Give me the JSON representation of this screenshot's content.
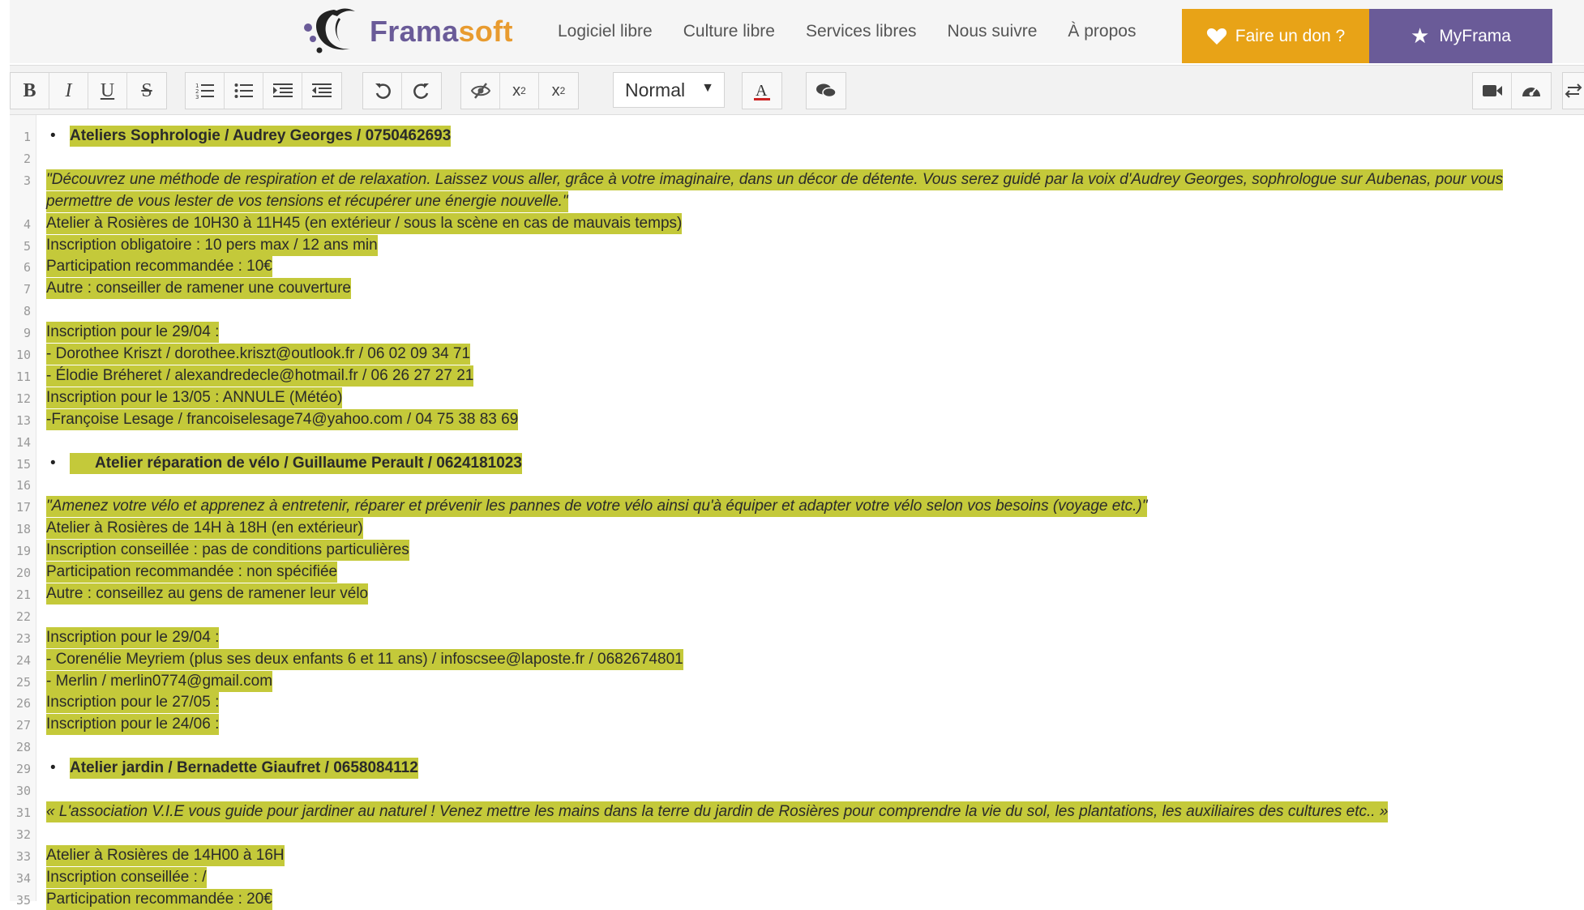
{
  "nav": {
    "brand_part1": "Frama",
    "brand_part2": "soft",
    "links": [
      "Logiciel libre",
      "Culture libre",
      "Services libres",
      "Nous suivre",
      "À propos"
    ],
    "donate_label": "Faire un don ?",
    "myframa_label": "MyFrama"
  },
  "toolbar": {
    "format_value": "Normal",
    "format_caret": "▼"
  },
  "lines": [
    {
      "n": "1",
      "bullet": true,
      "text": "Ateliers Sophrologie / Audrey Georges / 0750462693",
      "style": "b"
    },
    {
      "n": "2",
      "text": ""
    },
    {
      "n": "3",
      "text": "\"Découvrez une méthode de respiration et de relaxation. Laissez vous aller, grâce à votre imaginaire, dans un décor de détente. Vous serez guidé par la voix d'Audrey Georges, sophrologue sur Aubenas, pour vous",
      "style": "i"
    },
    {
      "n": "",
      "text": "permettre de vous lester de vos tensions et récupérer une énergie nouvelle.\"",
      "style": "i"
    },
    {
      "n": "4",
      "text": "Atelier à Rosières de 10H30 à 11H45 (en extérieur / sous la scène en cas de mauvais temps)"
    },
    {
      "n": "5",
      "text": "Inscription obligatoire : 10 pers max / 12 ans min"
    },
    {
      "n": "6",
      "text": "Participation recommandée : 10€"
    },
    {
      "n": "7",
      "text": "Autre : conseiller de ramener une couverture"
    },
    {
      "n": "8",
      "text": ""
    },
    {
      "n": "9",
      "text": "Inscription pour le 29/04 :"
    },
    {
      "n": "10",
      "text": "- Dorothee Kriszt / dorothee.kriszt@outlook.fr / 06 02 09 34 71"
    },
    {
      "n": "11",
      "text": "- Élodie Bréheret / alexandredecle@hotmail.fr / 06 26 27 27 21"
    },
    {
      "n": "12",
      "text": "Inscription pour le 13/05 : ANNULE (Météo)"
    },
    {
      "n": "13",
      "text": "-Françoise Lesage / francoiselesage74@yahoo.com / 04 75 38 83 69"
    },
    {
      "n": "14",
      "text": ""
    },
    {
      "n": "15",
      "bullet": true,
      "text": "      Atelier réparation de vélo / Guillaume Perault / 0624181023",
      "style": "b"
    },
    {
      "n": "16",
      "text": ""
    },
    {
      "n": "17",
      "text": "\"Amenez votre vélo et apprenez à entretenir, réparer et prévenir les pannes de votre vélo ainsi qu'à équiper et adapter votre vélo selon vos besoins (voyage etc.)\"",
      "style": "i"
    },
    {
      "n": "18",
      "text": "Atelier à Rosières de 14H à 18H (en extérieur)"
    },
    {
      "n": "19",
      "text": "Inscription conseillée : pas de conditions particulières"
    },
    {
      "n": "20",
      "text": "Participation recommandée : non spécifiée"
    },
    {
      "n": "21",
      "text": "Autre : conseillez au gens de ramener leur vélo"
    },
    {
      "n": "22",
      "text": ""
    },
    {
      "n": "23",
      "text": "Inscription pour le 29/04 :"
    },
    {
      "n": "24",
      "text": "- Corenélie Meyriem (plus ses deux enfants 6 et 11 ans) / infoscsee@laposte.fr / 0682674801"
    },
    {
      "n": "25",
      "text": "- Merlin / merlin0774@gmail.com"
    },
    {
      "n": "26",
      "text": "Inscription pour le 27/05 :"
    },
    {
      "n": "27",
      "text": "Inscription pour le 24/06 :"
    },
    {
      "n": "28",
      "text": ""
    },
    {
      "n": "29",
      "bullet": true,
      "text": "Atelier jardin / Bernadette Giaufret / 0658084112",
      "style": "b"
    },
    {
      "n": "30",
      "text": ""
    },
    {
      "n": "31",
      "text": "« L'association V.I.E vous guide pour jardiner au naturel ! Venez mettre les mains dans la terre du jardin de Rosières pour comprendre la vie du sol, les plantations, les auxiliaires des cultures etc.. »",
      "style": "i"
    },
    {
      "n": "32",
      "text": ""
    },
    {
      "n": "33",
      "text": "Atelier à Rosières de 14H00 à 16H"
    },
    {
      "n": "34",
      "text": "Inscription conseillée : /"
    },
    {
      "n": "35",
      "text": "Participation recommandée : 20€"
    }
  ]
}
